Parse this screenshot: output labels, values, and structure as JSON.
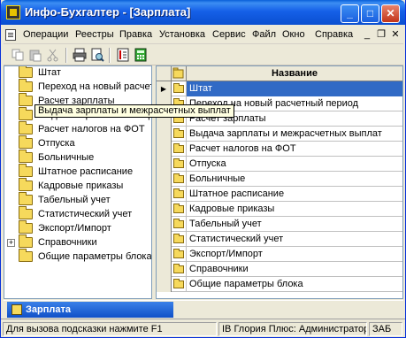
{
  "window": {
    "title": "Инфо-Бухгалтер - [Зарплата]"
  },
  "menu": [
    "Операции",
    "Реестры",
    "Правка",
    "Установка",
    "Сервис",
    "Файл",
    "Окно",
    "Справка"
  ],
  "tree": {
    "items": [
      {
        "label": "Штат"
      },
      {
        "label": "Переход на новый расчетн"
      },
      {
        "label": "Расчет зарплаты"
      },
      {
        "label": "Выдача зарплаты и межрасчетных выплат"
      },
      {
        "label": "Расчет налогов на ФОТ"
      },
      {
        "label": "Отпуска"
      },
      {
        "label": "Больничные"
      },
      {
        "label": "Штатное расписание"
      },
      {
        "label": "Кадровые приказы"
      },
      {
        "label": "Табельный учет"
      },
      {
        "label": "Статистический учет"
      },
      {
        "label": "Экспорт/Импорт"
      },
      {
        "label": "Справочники",
        "expander": "+"
      },
      {
        "label": "Общие параметры блока"
      }
    ],
    "tooltip": "Выдача зарплаты и межрасчетных выплат"
  },
  "grid": {
    "header": "Название",
    "rows": [
      "Штат",
      "Переход на новый расчетный период",
      "Расчет зарплаты",
      "Выдача зарплаты и межрасчетных выплат",
      "Расчет налогов на ФОТ",
      "Отпуска",
      "Больничные",
      "Штатное расписание",
      "Кадровые приказы",
      "Табельный учет",
      "Статистический учет",
      "Экспорт/Импорт",
      "Справочники",
      "Общие параметры блока"
    ],
    "selected_index": 0
  },
  "taskbar": {
    "label": "Зарплата"
  },
  "status": {
    "hint": "Для вызова подсказки нажмите F1",
    "db": "IB Глория Плюс: Администратор",
    "lang": "ЗАБ"
  },
  "colors": {
    "title": "#0a4fd0",
    "selection": "#316ac5",
    "tooltip": "#ffffe1"
  }
}
